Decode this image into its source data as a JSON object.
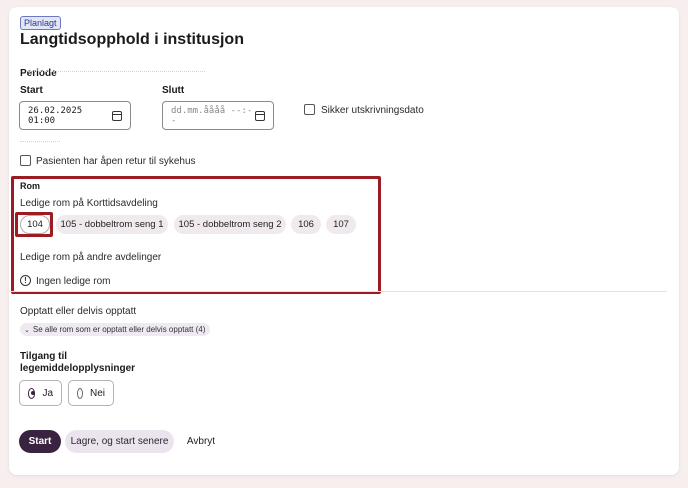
{
  "status_badge": "Planlagt",
  "title": "Langtidsopphold i institusjon",
  "periode": {
    "label": "Periode",
    "start_label": "Start",
    "start_value": "26.02.2025 01:00",
    "slutt_label": "Slutt",
    "slutt_placeholder": "dd.mm.åååå --:--",
    "sikker_label": "Sikker utskrivningsdato"
  },
  "retur_label": "Pasienten har åpen retur til sykehus",
  "rom": {
    "label": "Rom",
    "ledige_korttid_label": "Ledige rom på Korttidsavdeling",
    "rooms": [
      "104",
      "105 - dobbeltrom seng 1",
      "105 - dobbeltrom seng 2",
      "106",
      "107"
    ],
    "selected": "104",
    "ledige_andre_label": "Ledige rom på andre avdelinger",
    "ingen_label": "Ingen ledige rom"
  },
  "opptatt": {
    "label": "Opptatt eller delvis opptatt",
    "toggle_label": "Se alle rom som er opptatt eller delvis opptatt (4)"
  },
  "tilgang": {
    "label_line1": "Tilgang til",
    "label_line2": "legemiddelopplysninger",
    "options": [
      "Ja",
      "Nei"
    ],
    "selected": "Ja"
  },
  "buttons": {
    "start": "Start",
    "save_later": "Lagre, og start senere",
    "cancel": "Avbryt"
  },
  "colors": {
    "primary": "#3a2340",
    "highlight": "#9b1c23",
    "badge_bg": "#e3e6f7"
  }
}
